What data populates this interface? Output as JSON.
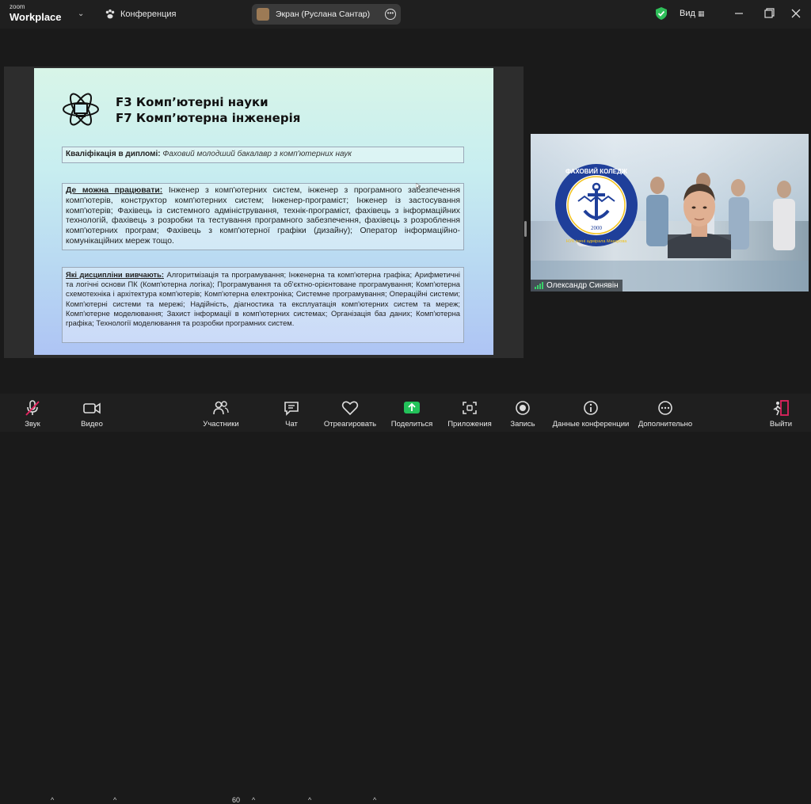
{
  "app": {
    "brand_small": "zoom",
    "brand_big": "Workplace",
    "conference_label": "Конференция",
    "share_label": "Экран (Руслана Сантар)",
    "view_label": "Вид"
  },
  "slide": {
    "title_line1": "F3 Комп’ютерні науки",
    "title_line2": "F7 Комп’ютерна інженерія",
    "qualification_label": "Кваліфікація в дипломі:",
    "qualification_value": "Фаховий молодший бакалавр з комп'ютерних наук",
    "work_label": "Де можна працювати:",
    "work_text": "Інженер з комп'ютерних систем, інженер з програмного забезпечення комп'ютерів, конструктор комп'ютерних систем; Інженер-програміст; Інженер із застосування комп'ютерів; Фахівець із системного адміністрування, технік-програміст, фахівець з інформаційних технологій, фахівець з розробки та тестування програмного забезпечення, фахівець з розроблення комп'ютерних програм; Фахівець з комп'ютерної графіки (дизайну); Оператор інформаційно-комунікаційних мереж тощо.",
    "disciplines_label": "Які дисципліни вивчають:",
    "disciplines_text": "Алгоритмізація та програмування; Інженерна та комп'ютерна графіка; Арифметичні та логічні основи ПК (Комп'ютерна логіка); Програмування та об'єктно-орієнтоване програмування; Комп'ютерна схемотехніка і архітектура комп'ютерів; Комп'ютерна електроніка; Системне програмування; Операційні системи; Комп'ютерні системи та мережі; Надійність, діагностика та експлуатація комп'ютерних систем та мереж; Комп'ютерне моделювання; Захист інформації в комп'ютерних системах; Організація баз даних; Комп'ютерна графіка; Технології моделювання та розробки програмних систем."
  },
  "video": {
    "participant_name": "Олександр Синявін",
    "logo_top": "ФАХОВИЙ КОЛЕДЖ",
    "logo_bottom": "НУК імені адмірала Макарова",
    "logo_year": "2000"
  },
  "toolbar": {
    "audio": "Звук",
    "video": "Видео",
    "participants": "Участники",
    "participants_count": "60",
    "chat": "Чат",
    "react": "Отреагировать",
    "share": "Поделиться",
    "apps": "Приложения",
    "record": "Запись",
    "info": "Данные конференции",
    "more": "Дополнительно",
    "leave": "Выйти"
  },
  "colors": {
    "share_green": "#23c25a",
    "leave_red": "#e0245e",
    "signal_green": "#3ad06a",
    "shield_green": "#2fbf5a"
  }
}
